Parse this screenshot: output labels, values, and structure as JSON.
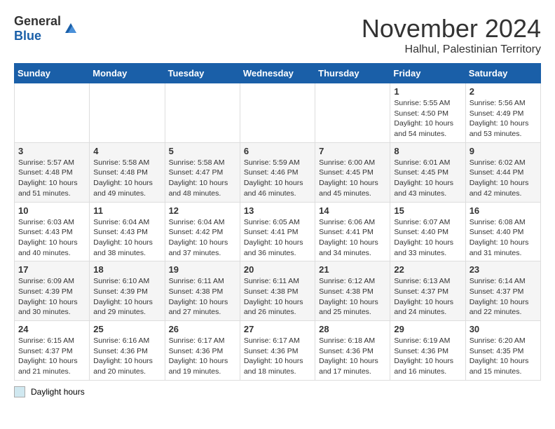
{
  "header": {
    "logo_general": "General",
    "logo_blue": "Blue",
    "month_title": "November 2024",
    "subtitle": "Halhul, Palestinian Territory"
  },
  "legend": {
    "box_label": "Daylight hours"
  },
  "weekdays": [
    "Sunday",
    "Monday",
    "Tuesday",
    "Wednesday",
    "Thursday",
    "Friday",
    "Saturday"
  ],
  "weeks": [
    [
      {
        "day": "",
        "info": ""
      },
      {
        "day": "",
        "info": ""
      },
      {
        "day": "",
        "info": ""
      },
      {
        "day": "",
        "info": ""
      },
      {
        "day": "",
        "info": ""
      },
      {
        "day": "1",
        "info": "Sunrise: 5:55 AM\nSunset: 4:50 PM\nDaylight: 10 hours and 54 minutes."
      },
      {
        "day": "2",
        "info": "Sunrise: 5:56 AM\nSunset: 4:49 PM\nDaylight: 10 hours and 53 minutes."
      }
    ],
    [
      {
        "day": "3",
        "info": "Sunrise: 5:57 AM\nSunset: 4:48 PM\nDaylight: 10 hours and 51 minutes."
      },
      {
        "day": "4",
        "info": "Sunrise: 5:58 AM\nSunset: 4:48 PM\nDaylight: 10 hours and 49 minutes."
      },
      {
        "day": "5",
        "info": "Sunrise: 5:58 AM\nSunset: 4:47 PM\nDaylight: 10 hours and 48 minutes."
      },
      {
        "day": "6",
        "info": "Sunrise: 5:59 AM\nSunset: 4:46 PM\nDaylight: 10 hours and 46 minutes."
      },
      {
        "day": "7",
        "info": "Sunrise: 6:00 AM\nSunset: 4:45 PM\nDaylight: 10 hours and 45 minutes."
      },
      {
        "day": "8",
        "info": "Sunrise: 6:01 AM\nSunset: 4:45 PM\nDaylight: 10 hours and 43 minutes."
      },
      {
        "day": "9",
        "info": "Sunrise: 6:02 AM\nSunset: 4:44 PM\nDaylight: 10 hours and 42 minutes."
      }
    ],
    [
      {
        "day": "10",
        "info": "Sunrise: 6:03 AM\nSunset: 4:43 PM\nDaylight: 10 hours and 40 minutes."
      },
      {
        "day": "11",
        "info": "Sunrise: 6:04 AM\nSunset: 4:43 PM\nDaylight: 10 hours and 38 minutes."
      },
      {
        "day": "12",
        "info": "Sunrise: 6:04 AM\nSunset: 4:42 PM\nDaylight: 10 hours and 37 minutes."
      },
      {
        "day": "13",
        "info": "Sunrise: 6:05 AM\nSunset: 4:41 PM\nDaylight: 10 hours and 36 minutes."
      },
      {
        "day": "14",
        "info": "Sunrise: 6:06 AM\nSunset: 4:41 PM\nDaylight: 10 hours and 34 minutes."
      },
      {
        "day": "15",
        "info": "Sunrise: 6:07 AM\nSunset: 4:40 PM\nDaylight: 10 hours and 33 minutes."
      },
      {
        "day": "16",
        "info": "Sunrise: 6:08 AM\nSunset: 4:40 PM\nDaylight: 10 hours and 31 minutes."
      }
    ],
    [
      {
        "day": "17",
        "info": "Sunrise: 6:09 AM\nSunset: 4:39 PM\nDaylight: 10 hours and 30 minutes."
      },
      {
        "day": "18",
        "info": "Sunrise: 6:10 AM\nSunset: 4:39 PM\nDaylight: 10 hours and 29 minutes."
      },
      {
        "day": "19",
        "info": "Sunrise: 6:11 AM\nSunset: 4:38 PM\nDaylight: 10 hours and 27 minutes."
      },
      {
        "day": "20",
        "info": "Sunrise: 6:11 AM\nSunset: 4:38 PM\nDaylight: 10 hours and 26 minutes."
      },
      {
        "day": "21",
        "info": "Sunrise: 6:12 AM\nSunset: 4:38 PM\nDaylight: 10 hours and 25 minutes."
      },
      {
        "day": "22",
        "info": "Sunrise: 6:13 AM\nSunset: 4:37 PM\nDaylight: 10 hours and 24 minutes."
      },
      {
        "day": "23",
        "info": "Sunrise: 6:14 AM\nSunset: 4:37 PM\nDaylight: 10 hours and 22 minutes."
      }
    ],
    [
      {
        "day": "24",
        "info": "Sunrise: 6:15 AM\nSunset: 4:37 PM\nDaylight: 10 hours and 21 minutes."
      },
      {
        "day": "25",
        "info": "Sunrise: 6:16 AM\nSunset: 4:36 PM\nDaylight: 10 hours and 20 minutes."
      },
      {
        "day": "26",
        "info": "Sunrise: 6:17 AM\nSunset: 4:36 PM\nDaylight: 10 hours and 19 minutes."
      },
      {
        "day": "27",
        "info": "Sunrise: 6:17 AM\nSunset: 4:36 PM\nDaylight: 10 hours and 18 minutes."
      },
      {
        "day": "28",
        "info": "Sunrise: 6:18 AM\nSunset: 4:36 PM\nDaylight: 10 hours and 17 minutes."
      },
      {
        "day": "29",
        "info": "Sunrise: 6:19 AM\nSunset: 4:36 PM\nDaylight: 10 hours and 16 minutes."
      },
      {
        "day": "30",
        "info": "Sunrise: 6:20 AM\nSunset: 4:35 PM\nDaylight: 10 hours and 15 minutes."
      }
    ]
  ]
}
